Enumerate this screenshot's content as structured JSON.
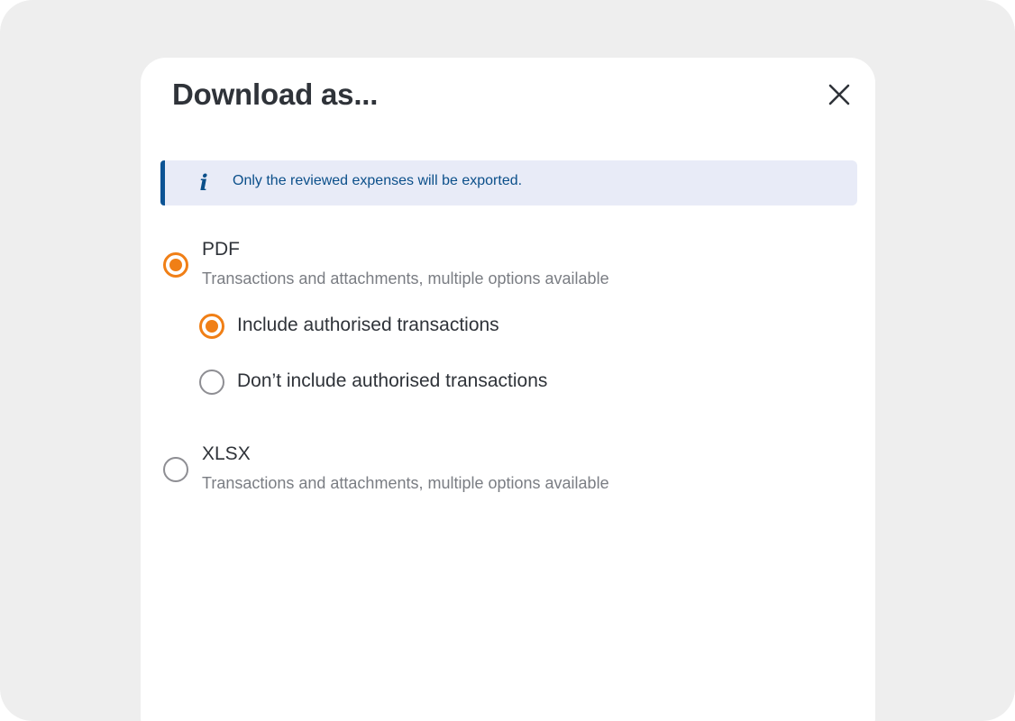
{
  "modal": {
    "title": "Download as...",
    "close_icon": "close-icon"
  },
  "info_banner": {
    "icon": "info-icon",
    "icon_glyph": "i",
    "text": "Only the reviewed expenses will be exported."
  },
  "formats": [
    {
      "label": "PDF",
      "description": "Transactions and attachments, multiple options available",
      "selected": true
    },
    {
      "label": "XLSX",
      "description": "Transactions and attachments, multiple options available",
      "selected": false
    }
  ],
  "pdf_options": [
    {
      "label": "Include authorised transactions",
      "selected": true
    },
    {
      "label": "Don’t include authorised transactions",
      "selected": false
    }
  ],
  "colors": {
    "accent": "#f07f16",
    "info": "#0b4f8a",
    "info_background": "#e8ebf7",
    "text": "#2f3339",
    "muted_text": "#7a7d83",
    "page_background": "#eeeeee"
  }
}
